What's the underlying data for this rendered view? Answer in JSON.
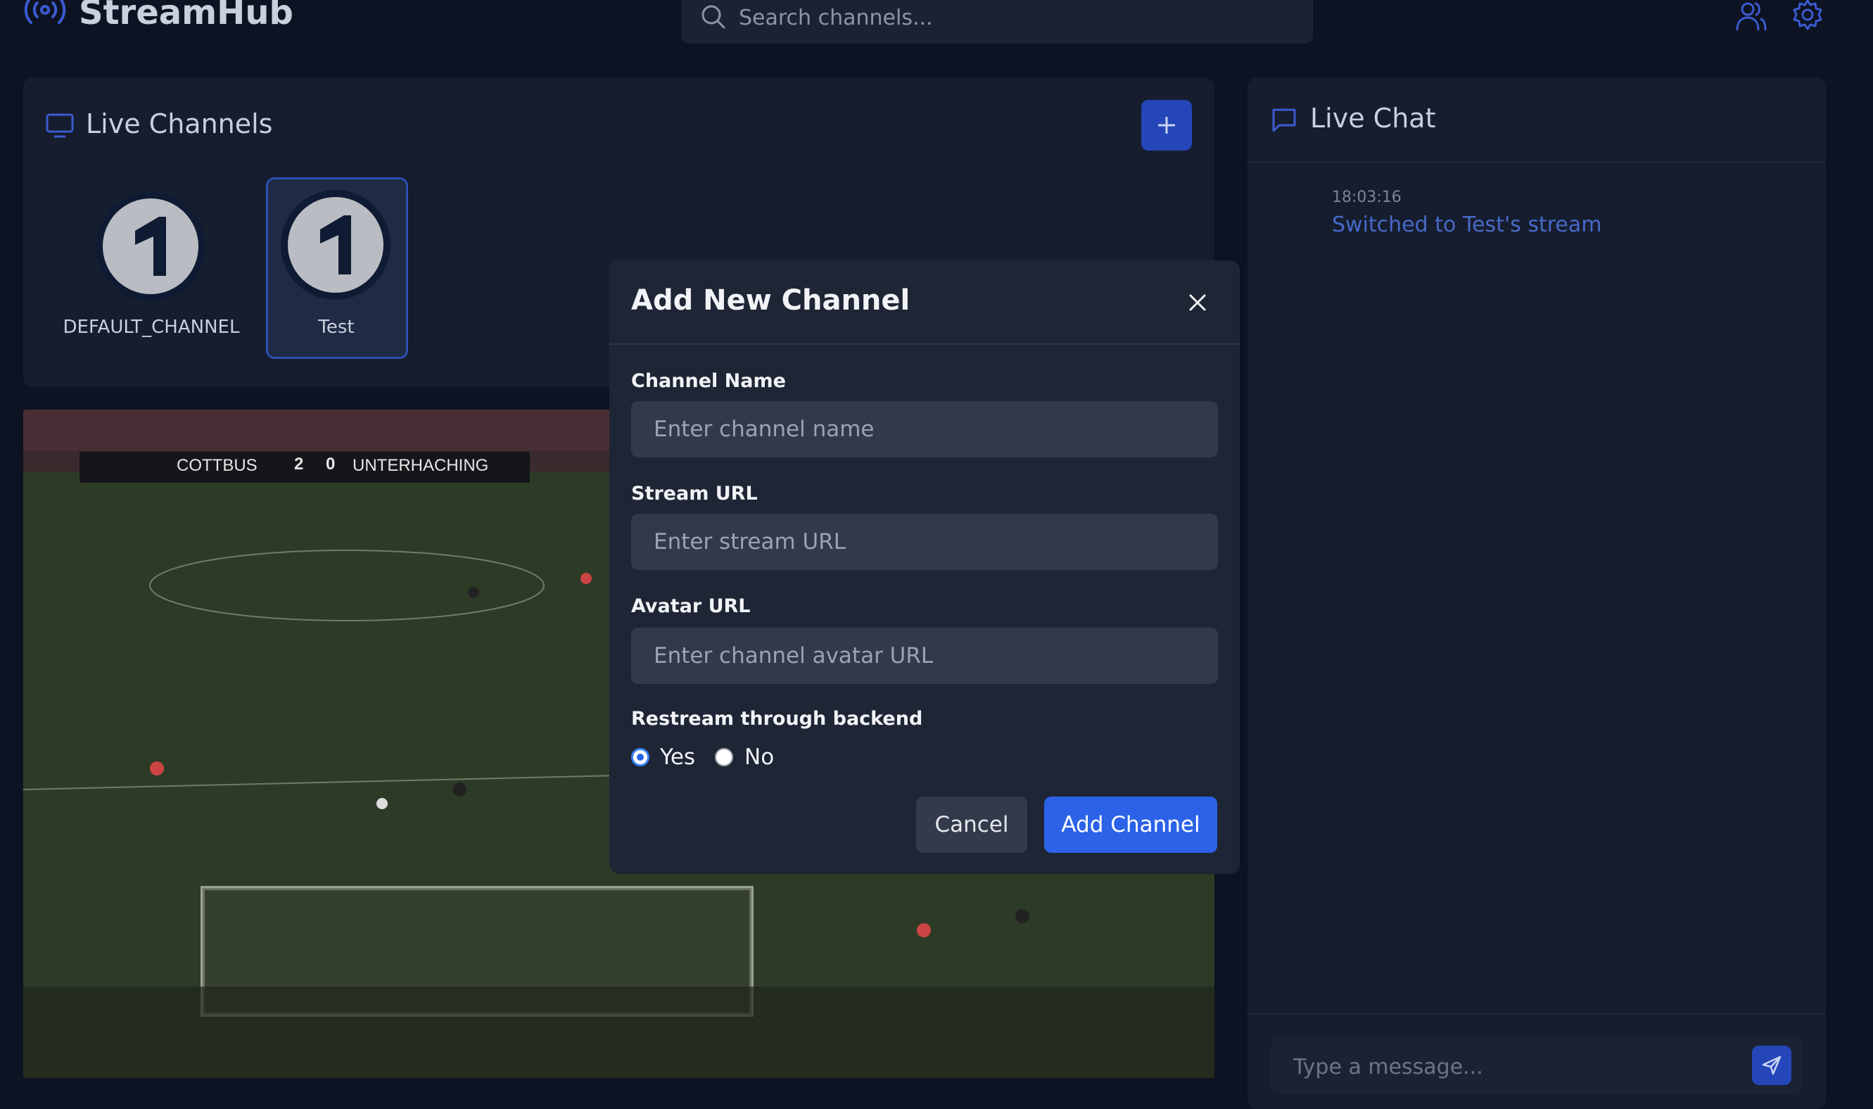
{
  "app": {
    "title": "StreamHub"
  },
  "header": {
    "search_placeholder": "Search channels..."
  },
  "channels": {
    "title": "Live Channels",
    "items": [
      {
        "label": "DEFAULT_CHANNEL",
        "active": false
      },
      {
        "label": "Test",
        "active": true
      }
    ]
  },
  "video": {
    "scoreboard": {
      "home": "COTTBUS",
      "home_score": "2",
      "away_score": "0",
      "away": "UNTERHACHING"
    }
  },
  "chat": {
    "title": "Live Chat",
    "messages": [
      {
        "time": "18:03:16",
        "text": "Switched to Test's stream"
      }
    ],
    "input_placeholder": "Type a message..."
  },
  "modal": {
    "title": "Add New Channel",
    "fields": {
      "name": {
        "label": "Channel Name",
        "placeholder": "Enter channel name",
        "value": ""
      },
      "stream": {
        "label": "Stream URL",
        "placeholder": "Enter stream URL",
        "value": ""
      },
      "avatar": {
        "label": "Avatar URL",
        "placeholder": "Enter channel avatar URL",
        "value": ""
      }
    },
    "restream": {
      "label": "Restream through backend",
      "options": [
        "Yes",
        "No"
      ],
      "selected": "Yes"
    },
    "cancel_label": "Cancel",
    "submit_label": "Add Channel"
  },
  "colors": {
    "background": "#0d1322",
    "panel": "#161d2e",
    "accent": "#2c62e8",
    "chat_message": "#4769c9"
  }
}
